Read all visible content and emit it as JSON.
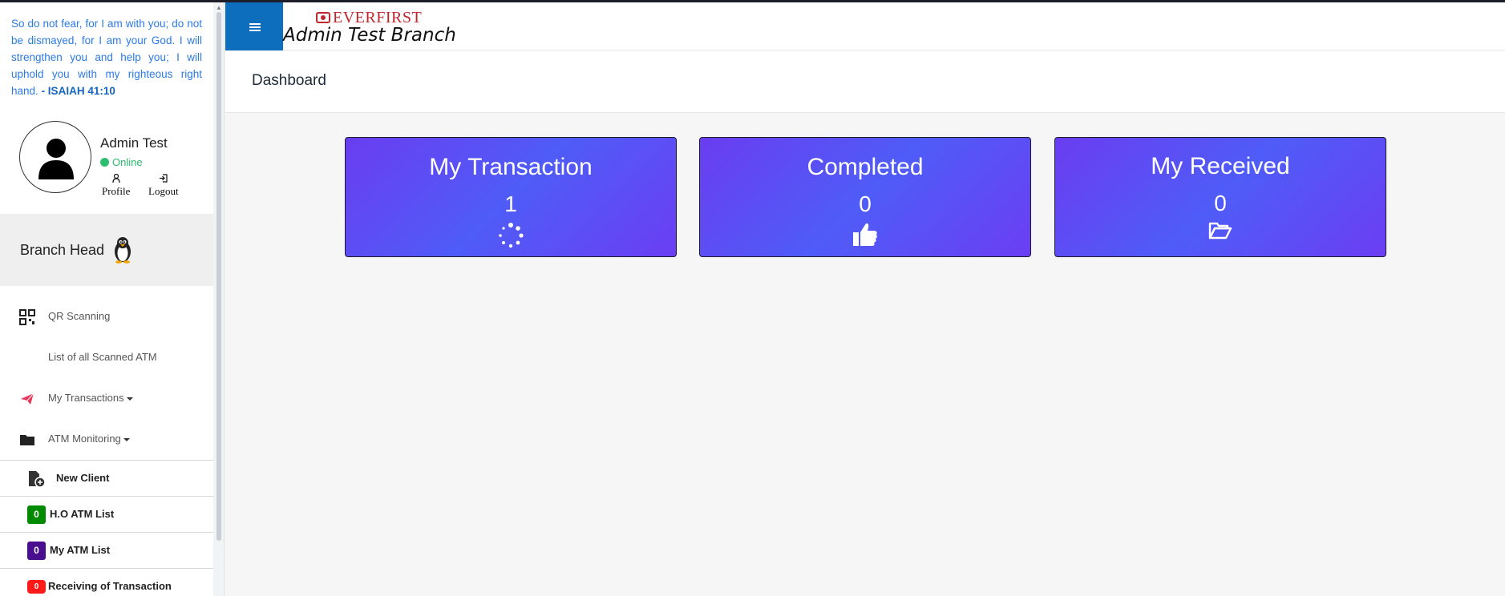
{
  "sidebar": {
    "verse_text": "So do not fear, for I am with you; do not be dismayed, for I am your God. I will strengthen you and help you; I will uphold you with my righteous right hand.",
    "verse_ref": "- ISAIAH 41:10",
    "user": {
      "name": "Admin Test",
      "status": "Online",
      "profile_label": "Profile",
      "logout_label": "Logout"
    },
    "role": "Branch Head",
    "nav": [
      {
        "label": "QR Scanning",
        "icon": "qr-code-icon"
      },
      {
        "label": "List of all Scanned ATM",
        "icon": ""
      },
      {
        "label": "My Transactions",
        "icon": "paper-plane-icon"
      },
      {
        "label": "ATM Monitoring",
        "icon": "folder-icon"
      }
    ],
    "menu": [
      {
        "label": "New Client",
        "icon": "file-add-icon"
      },
      {
        "label": "H.O ATM List",
        "badge": "0",
        "badge_color": "#008a00"
      },
      {
        "label": "My ATM List",
        "badge": "0",
        "badge_color": "#4a0f8f"
      },
      {
        "label": "Receiving of Transaction",
        "badge": "0",
        "badge_color": "#ff1a1a"
      }
    ]
  },
  "header": {
    "logo_text": "EVERFIRST",
    "branch_name": "Admin Test Branch"
  },
  "page": {
    "title": "Dashboard"
  },
  "cards": [
    {
      "title": "My Transaction",
      "count": "1",
      "icon": "spinner-icon"
    },
    {
      "title": "Completed",
      "count": "0",
      "icon": "thumbs-up-icon"
    },
    {
      "title": "My Received",
      "count": "0",
      "icon": "folder-open-icon"
    }
  ],
  "colors": {
    "accent": "#0d6ebd",
    "card_gradient_start": "#6a3df0",
    "card_gradient_mid": "#4f5cf7",
    "online": "#2dbd6e",
    "verse": "#2c7be5"
  }
}
